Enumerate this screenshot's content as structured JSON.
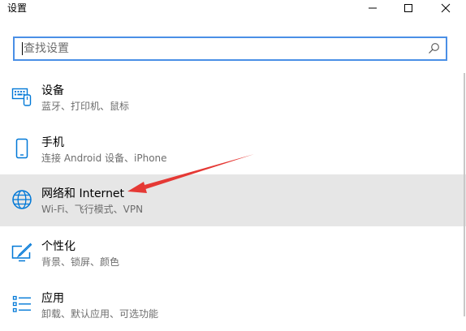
{
  "window": {
    "title": "设置"
  },
  "search": {
    "placeholder": "查找设置"
  },
  "items": [
    {
      "label": "设备",
      "desc": "蓝牙、打印机、鼠标",
      "icon": "devices-icon"
    },
    {
      "label": "手机",
      "desc": "连接 Android 设备、iPhone",
      "icon": "phone-icon"
    },
    {
      "label": "网络和 Internet",
      "desc": "Wi-Fi、飞行模式、VPN",
      "icon": "globe-icon",
      "highlighted": true
    },
    {
      "label": "个性化",
      "desc": "背景、锁屏、颜色",
      "icon": "personalization-icon"
    },
    {
      "label": "应用",
      "desc": "卸载、默认应用、可选功能",
      "icon": "apps-icon"
    }
  ],
  "colors": {
    "accent": "#0078d7",
    "highlight": "#e6e6e6",
    "annotation": "#e53935",
    "search_border": "#4a8fe6"
  }
}
